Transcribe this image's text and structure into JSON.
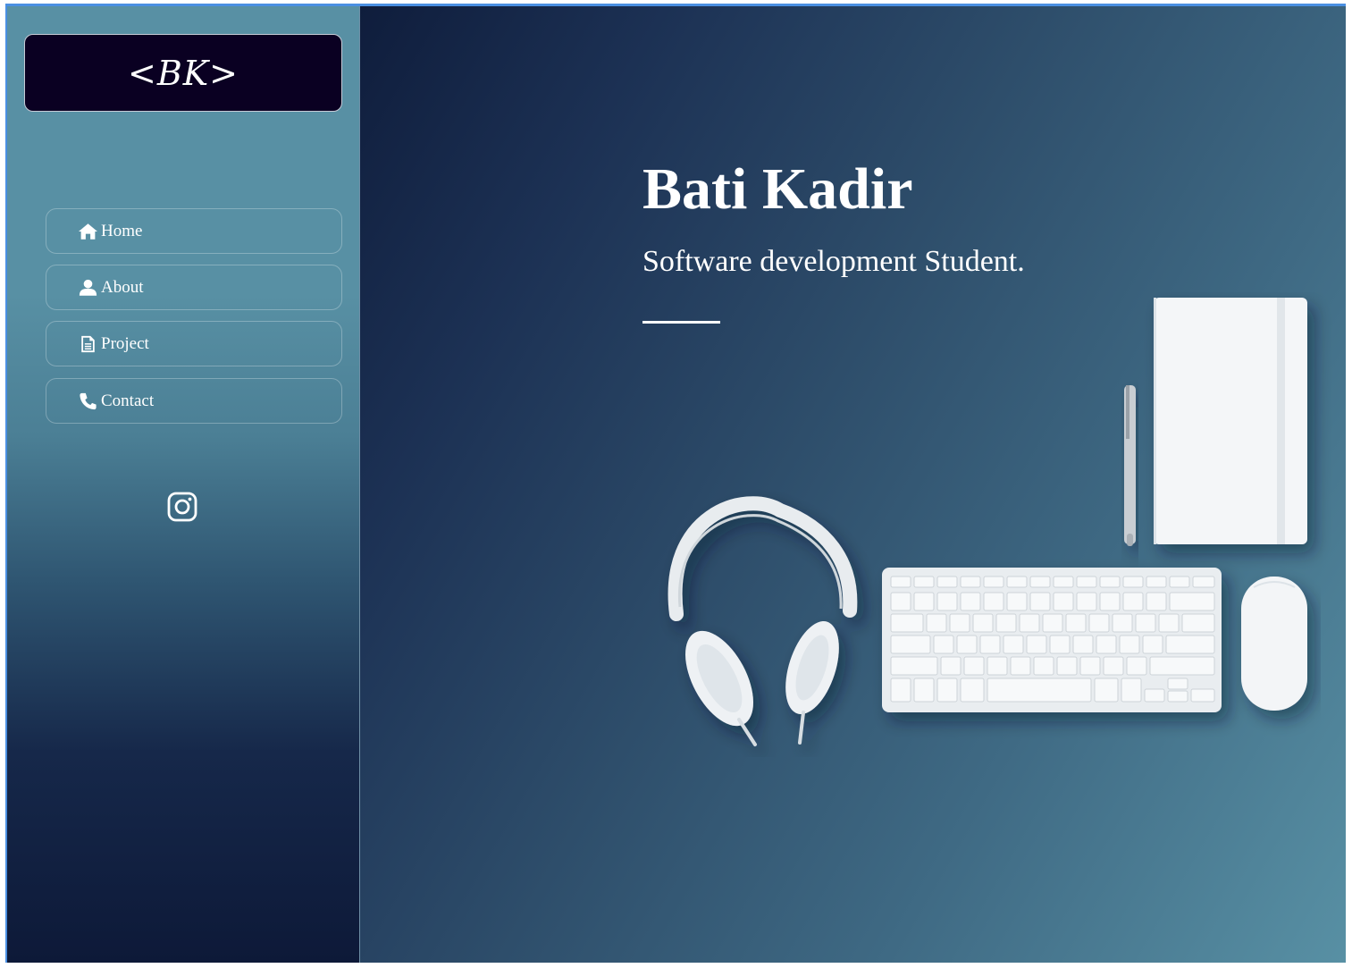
{
  "logo": {
    "text": "<BK>"
  },
  "nav": {
    "items": [
      {
        "label": "Home",
        "icon": "home-icon"
      },
      {
        "label": "About",
        "icon": "user-icon"
      },
      {
        "label": "Project",
        "icon": "document-icon"
      },
      {
        "label": "Contact",
        "icon": "phone-icon"
      }
    ]
  },
  "social": {
    "icon": "instagram-icon"
  },
  "hero": {
    "name": "Bati Kadir",
    "tagline": "Software development Student."
  },
  "colors": {
    "frame_border": "#4a8fe2",
    "logo_bg": "#0a0022",
    "sidebar_top": "#5890a4",
    "sidebar_bottom": "#0d1938",
    "text": "#ffffff"
  }
}
